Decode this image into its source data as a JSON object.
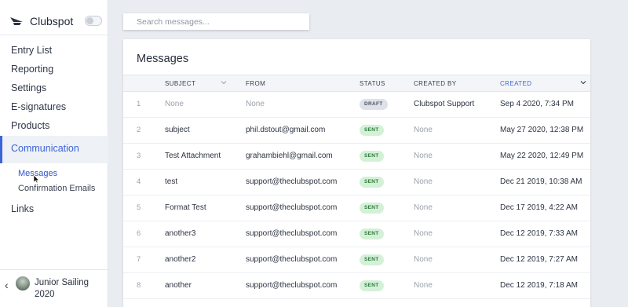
{
  "app": {
    "name": "Clubspot"
  },
  "sidebar": {
    "items": [
      {
        "label": "Entry List"
      },
      {
        "label": "Reporting"
      },
      {
        "label": "Settings"
      },
      {
        "label": "E-signatures"
      },
      {
        "label": "Products"
      },
      {
        "label": "Communication",
        "active": true
      },
      {
        "label": "Links"
      }
    ],
    "subitems": [
      {
        "label": "Messages",
        "active": true
      },
      {
        "label": "Confirmation Emails"
      }
    ],
    "profile": {
      "name": "Junior Sailing 2020"
    }
  },
  "search": {
    "placeholder": "Search messages..."
  },
  "messages": {
    "title": "Messages",
    "columns": {
      "subject": "SUBJECT",
      "from": "FROM",
      "status": "STATUS",
      "created_by": "CREATED BY",
      "created": "CREATED"
    },
    "rows": [
      {
        "num": "1",
        "subject": "None",
        "from": "None",
        "status": "DRAFT",
        "created_by": "Clubspot Support",
        "created": "Sep 4 2020, 7:34 PM"
      },
      {
        "num": "2",
        "subject": "subject",
        "from": "phil.dstout@gmail.com",
        "status": "SENT",
        "created_by": "None",
        "created": "May 27 2020, 12:38 PM"
      },
      {
        "num": "3",
        "subject": "Test Attachment",
        "from": "grahambiehl@gmail.com",
        "status": "SENT",
        "created_by": "None",
        "created": "May 22 2020, 12:49 PM"
      },
      {
        "num": "4",
        "subject": "test",
        "from": "support@theclubspot.com",
        "status": "SENT",
        "created_by": "None",
        "created": "Dec 21 2019, 10:38 AM"
      },
      {
        "num": "5",
        "subject": "Format Test",
        "from": "support@theclubspot.com",
        "status": "SENT",
        "created_by": "None",
        "created": "Dec 17 2019, 4:22 AM"
      },
      {
        "num": "6",
        "subject": "another3",
        "from": "support@theclubspot.com",
        "status": "SENT",
        "created_by": "None",
        "created": "Dec 12 2019, 7:33 AM"
      },
      {
        "num": "7",
        "subject": "another2",
        "from": "support@theclubspot.com",
        "status": "SENT",
        "created_by": "None",
        "created": "Dec 12 2019, 7:27 AM"
      },
      {
        "num": "8",
        "subject": "another",
        "from": "support@theclubspot.com",
        "status": "SENT",
        "created_by": "None",
        "created": "Dec 12 2019, 7:18 AM"
      }
    ]
  },
  "colors": {
    "accent": "#3b65d8",
    "sent_badge": "#d4f1d8",
    "draft_badge": "#dee2e8",
    "background": "#e9ecf1"
  }
}
